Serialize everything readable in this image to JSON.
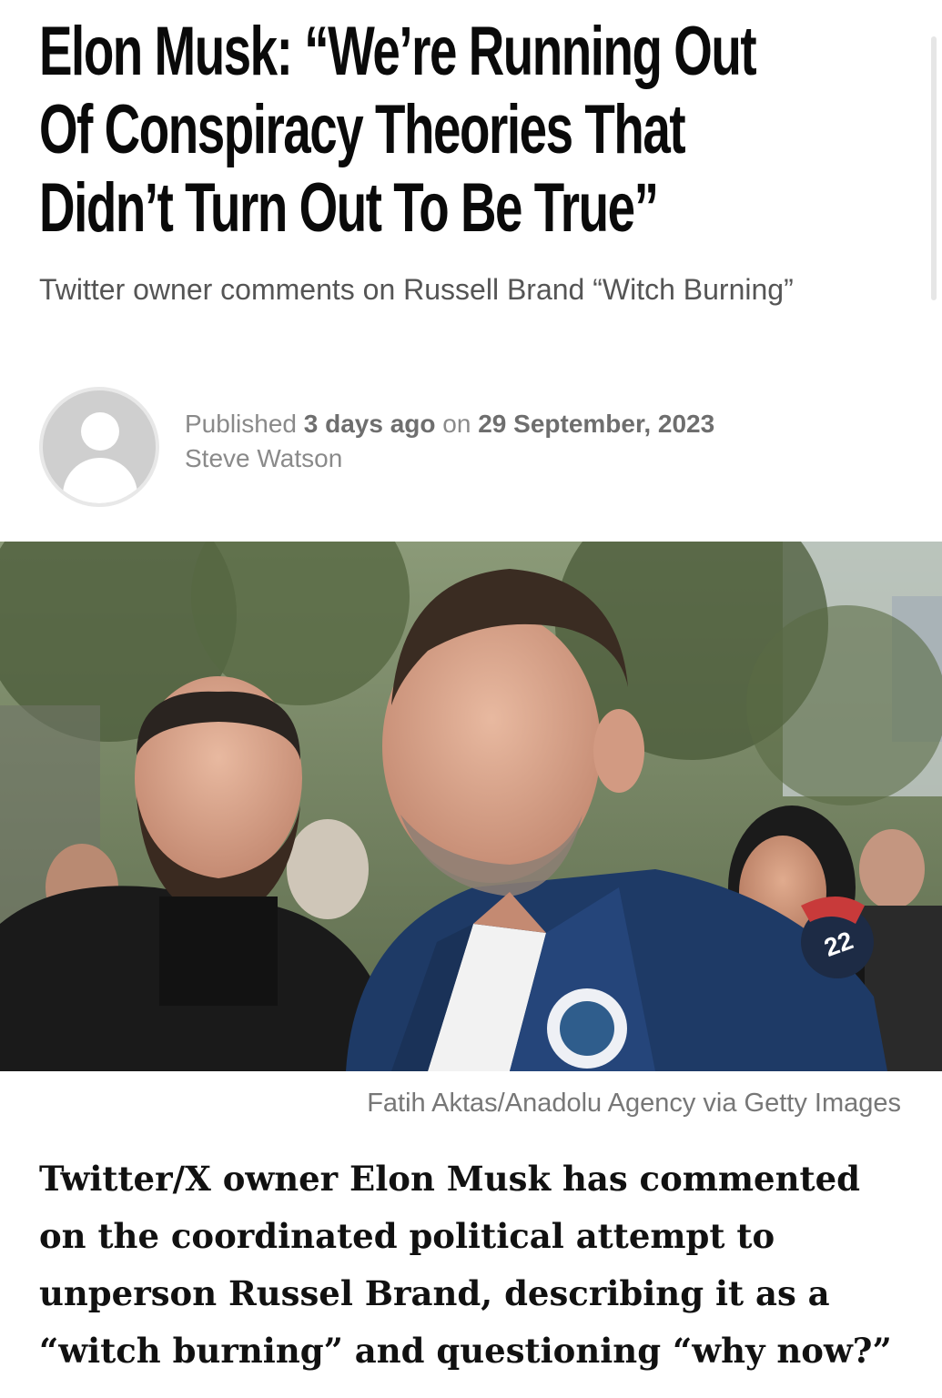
{
  "article": {
    "headline_lines": [
      "Elon Musk: “We’re Running Out",
      "Of Conspiracy Theories That",
      "Didn’t Turn Out To Be True”"
    ],
    "subtitle": "Twitter owner comments on Russell Brand “Witch Burning”",
    "meta": {
      "published_label": "Published",
      "relative_time": "3 days ago",
      "on_label": "on",
      "date": "29 September, 2023",
      "author": "Steve Watson"
    },
    "image_caption": "Fatih Aktas/Anadolu Agency via Getty Images",
    "lede": "Twitter/X owner Elon Musk has commented on the coordinated political attempt to unperson Russel Brand, describing it as a “witch burning” and questioning “why now?”"
  },
  "photo_text": {
    "patch_number": "22"
  },
  "icons": {
    "avatar": "default-user-avatar-icon"
  },
  "colors": {
    "headline": "#0a0a0a",
    "subtitle": "#555555",
    "meta": "#8a8a8a",
    "jacket": "#1e3a66"
  }
}
